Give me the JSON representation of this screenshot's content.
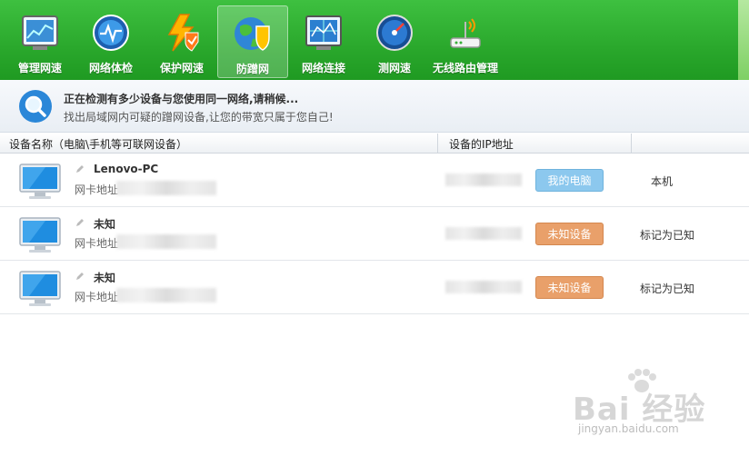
{
  "toolbar": {
    "items": [
      {
        "label": "管理网速",
        "icon": "speed-chart-icon"
      },
      {
        "label": "网络体检",
        "icon": "network-check-icon"
      },
      {
        "label": "保护网速",
        "icon": "shield-lightning-icon"
      },
      {
        "label": "防蹭网",
        "icon": "globe-shield-icon",
        "active": true
      },
      {
        "label": "网络连接",
        "icon": "network-monitor-icon"
      },
      {
        "label": "测网速",
        "icon": "speedometer-icon"
      },
      {
        "label": "无线路由管理",
        "icon": "wifi-router-icon"
      }
    ]
  },
  "status": {
    "title": "正在检测有多少设备与您使用同一网络,请稍候...",
    "subtitle": "找出局域网内可疑的蹭网设备,让您的带宽只属于您自己!"
  },
  "table": {
    "headers": [
      "设备名称（电脑\\手机等可联网设备）",
      "设备的IP地址",
      ""
    ],
    "rows": [
      {
        "name": "Lenovo-PC",
        "mac_label": "网卡地址",
        "badge": "我的电脑",
        "badge_color": "blue",
        "action": "本机"
      },
      {
        "name": "未知",
        "mac_label": "网卡地址",
        "badge": "未知设备",
        "badge_color": "orange",
        "action": "标记为已知"
      },
      {
        "name": "未知",
        "mac_label": "网卡地址",
        "badge": "未知设备",
        "badge_color": "orange",
        "action": "标记为已知"
      }
    ]
  },
  "watermark": {
    "brand": "Bai 经验",
    "url": "jingyan.baidu.com"
  },
  "colors": {
    "toolbar_green": "#2aa82c",
    "badge_blue": "#8cc8ee",
    "badge_orange": "#e9a06a"
  }
}
